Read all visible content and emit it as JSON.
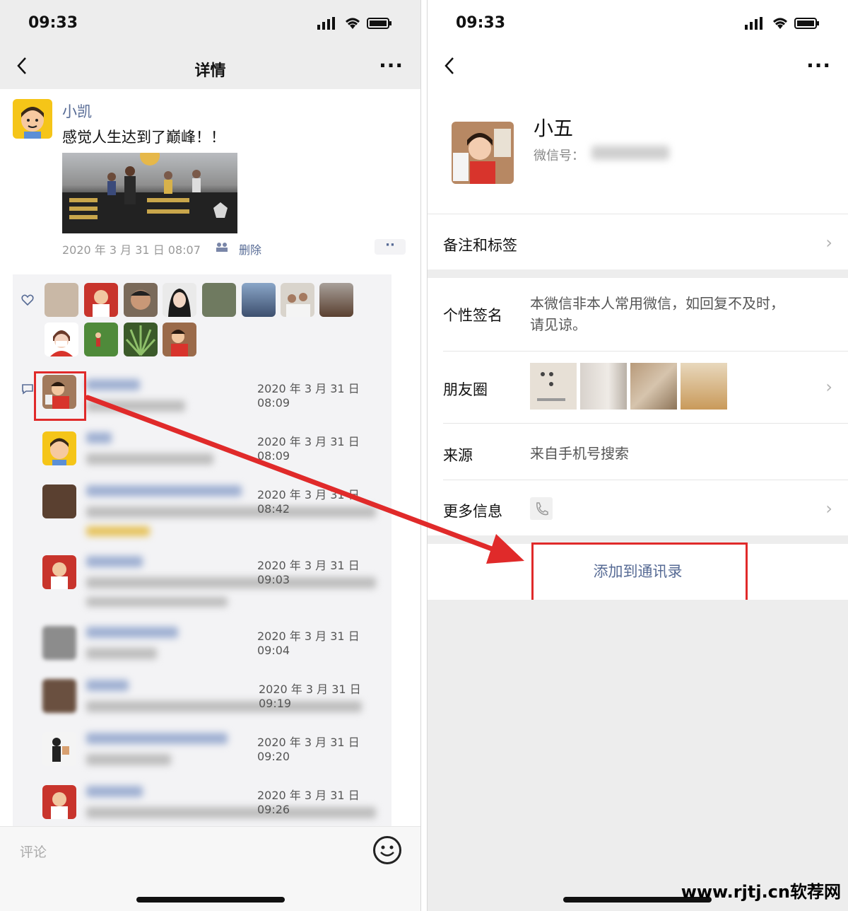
{
  "left": {
    "status_time": "09:33",
    "nav_title": "详情",
    "nav_more": "···",
    "post": {
      "author": "小凯",
      "text": "感觉人生达到了巅峰！！",
      "meta": "2020 年 3 月 31 日  08:07",
      "delete_label": "删除",
      "more": "··"
    },
    "comment_times": [
      "2020 年 3 月 31 日  08:09",
      "2020 年 3 月 31 日  08:09",
      "2020 年 3 月 31 日  08:42",
      "2020 年 3 月 31 日  09:03",
      "2020 年 3 月 31 日  09:04",
      "2020 年 3 月 31 日  09:19",
      "2020 年 3 月 31 日  09:20",
      "2020 年 3 月 31 日  09:26"
    ],
    "comment_placeholder": "评论"
  },
  "right": {
    "status_time": "09:33",
    "nav_more": "···",
    "profile": {
      "name": "小五",
      "wechat_id_label": "微信号："
    },
    "rows": {
      "remark": "备注和标签",
      "signature_label": "个性签名",
      "signature_value": "本微信非本人常用微信，如回复不及时，请见谅。",
      "moments_label": "朋友圈",
      "source_label": "来源",
      "source_value": "来自手机号搜索",
      "more_info_label": "更多信息"
    },
    "add_button": "添加到通讯录"
  },
  "watermark": "www.rjtj.cn软荐网",
  "colors": {
    "link_blue": "#576b95",
    "highlight_red": "#e02a2a",
    "bg_gray": "#ededed"
  }
}
